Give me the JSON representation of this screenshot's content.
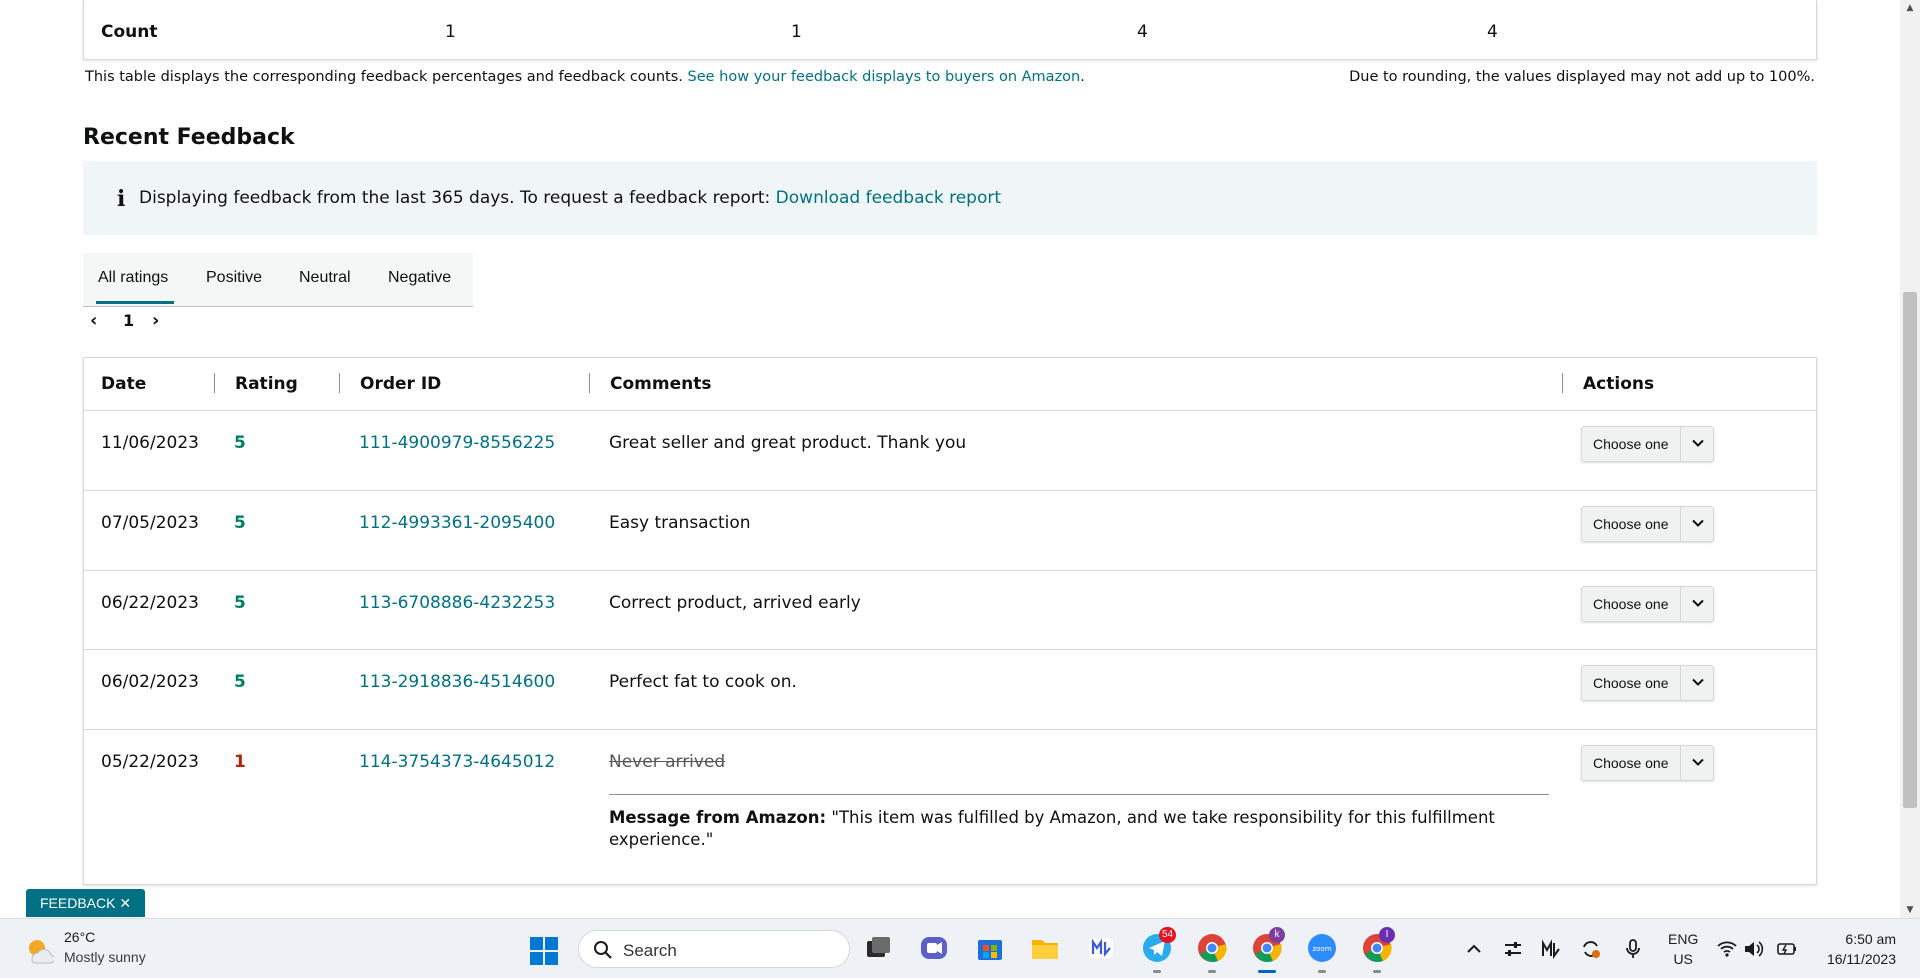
{
  "count_row": {
    "label": "Count",
    "values": [
      "1",
      "1",
      "4",
      "4"
    ]
  },
  "notes": {
    "left_text": "This table displays the corresponding feedback percentages and feedback counts. ",
    "left_link": "See how your feedback displays to buyers on Amazon",
    "left_end": ".",
    "right_text": "Due to rounding, the values displayed may not add up to 100%."
  },
  "section_title": "Recent Feedback",
  "info": {
    "icon": "i",
    "text": "Displaying feedback from the last 365 days. To request a feedback report: ",
    "link": "Download feedback report"
  },
  "tabs": [
    {
      "label": "All ratings",
      "active": true
    },
    {
      "label": "Positive",
      "active": false
    },
    {
      "label": "Neutral",
      "active": false
    },
    {
      "label": "Negative",
      "active": false
    }
  ],
  "pager": {
    "prev": "‹",
    "current": "1",
    "next": "›"
  },
  "table": {
    "headers": [
      "Date",
      "Rating",
      "Order ID",
      "Comments",
      "Actions"
    ],
    "rows": [
      {
        "date": "11/06/2023",
        "rating": "5",
        "order_id": "111-4900979-8556225",
        "comment": "Great seller and great product. Thank you",
        "action": "Choose one"
      },
      {
        "date": "07/05/2023",
        "rating": "5",
        "order_id": "112-4993361-2095400",
        "comment": "Easy transaction",
        "action": "Choose one"
      },
      {
        "date": "06/22/2023",
        "rating": "5",
        "order_id": "113-6708886-4232253",
        "comment": "Correct product, arrived early",
        "action": "Choose one"
      },
      {
        "date": "06/02/2023",
        "rating": "5",
        "order_id": "113-2918836-4514600",
        "comment": "Perfect fat to cook on.",
        "action": "Choose one"
      },
      {
        "date": "05/22/2023",
        "rating": "1",
        "order_id": "114-3754373-4645012",
        "comment": "Never arrived",
        "action": "Choose one",
        "amazon_label": "Message from Amazon:",
        "amazon_text": " \"This item was fulfilled by Amazon, and we take responsibility for this fulfillment experience.\""
      }
    ]
  },
  "feedback_tab": "FEEDBACK ✕",
  "taskbar": {
    "weather_temp": "26°C",
    "weather_desc": "Mostly sunny",
    "search": "Search",
    "telegram_badge": "54",
    "chrome_badge_k": "k",
    "chrome_badge_i": "I",
    "zoom_label": "zoom",
    "lang_top": "ENG",
    "lang_bottom": "US",
    "time": "6:50 am",
    "date": "16/11/2023"
  },
  "colors": {
    "link": "#007185",
    "positive": "#067d62",
    "negative": "#b12704",
    "info_bg": "#f0f6f7",
    "feedback_tab": "#007185"
  }
}
